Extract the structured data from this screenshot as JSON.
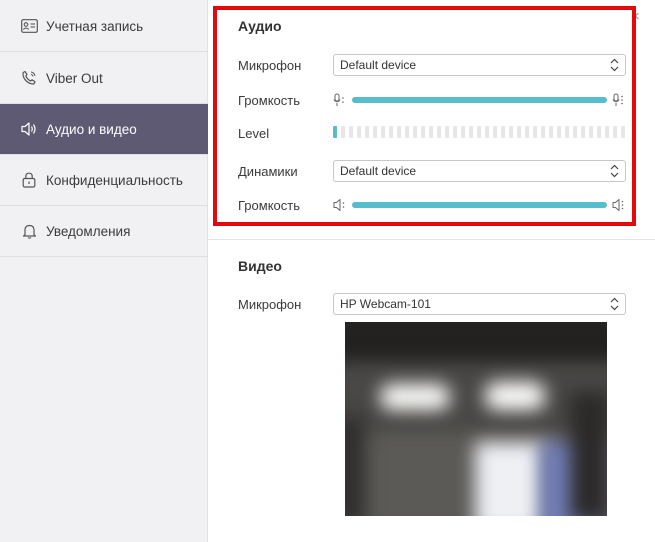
{
  "sidebar": {
    "items": [
      {
        "label": "Учетная запись",
        "icon": "id-card-icon"
      },
      {
        "label": "Viber Out",
        "icon": "phone-icon"
      },
      {
        "label": "Аудио и видео",
        "icon": "speaker-icon",
        "active": true
      },
      {
        "label": "Конфиденциальность",
        "icon": "lock-icon"
      },
      {
        "label": "Уведомления",
        "icon": "bell-icon"
      }
    ]
  },
  "close_glyph": "×",
  "audio": {
    "title": "Аудио",
    "mic_label": "Микрофон",
    "mic_value": "Default device",
    "mic_volume_label": "Громкость",
    "mic_volume_fraction": 1.0,
    "level_label": "Level",
    "level_segments_active": 1,
    "speakers_label": "Динамики",
    "speakers_value": "Default device",
    "speaker_volume_label": "Громкость",
    "speaker_volume_fraction": 1.0
  },
  "video": {
    "title": "Видео",
    "camera_label": "Микрофон",
    "camera_value": "HP Webcam-101"
  },
  "colors": {
    "accent": "#59bccb",
    "sidebar_active": "#5f5a73",
    "highlight": "#e20a0a"
  }
}
